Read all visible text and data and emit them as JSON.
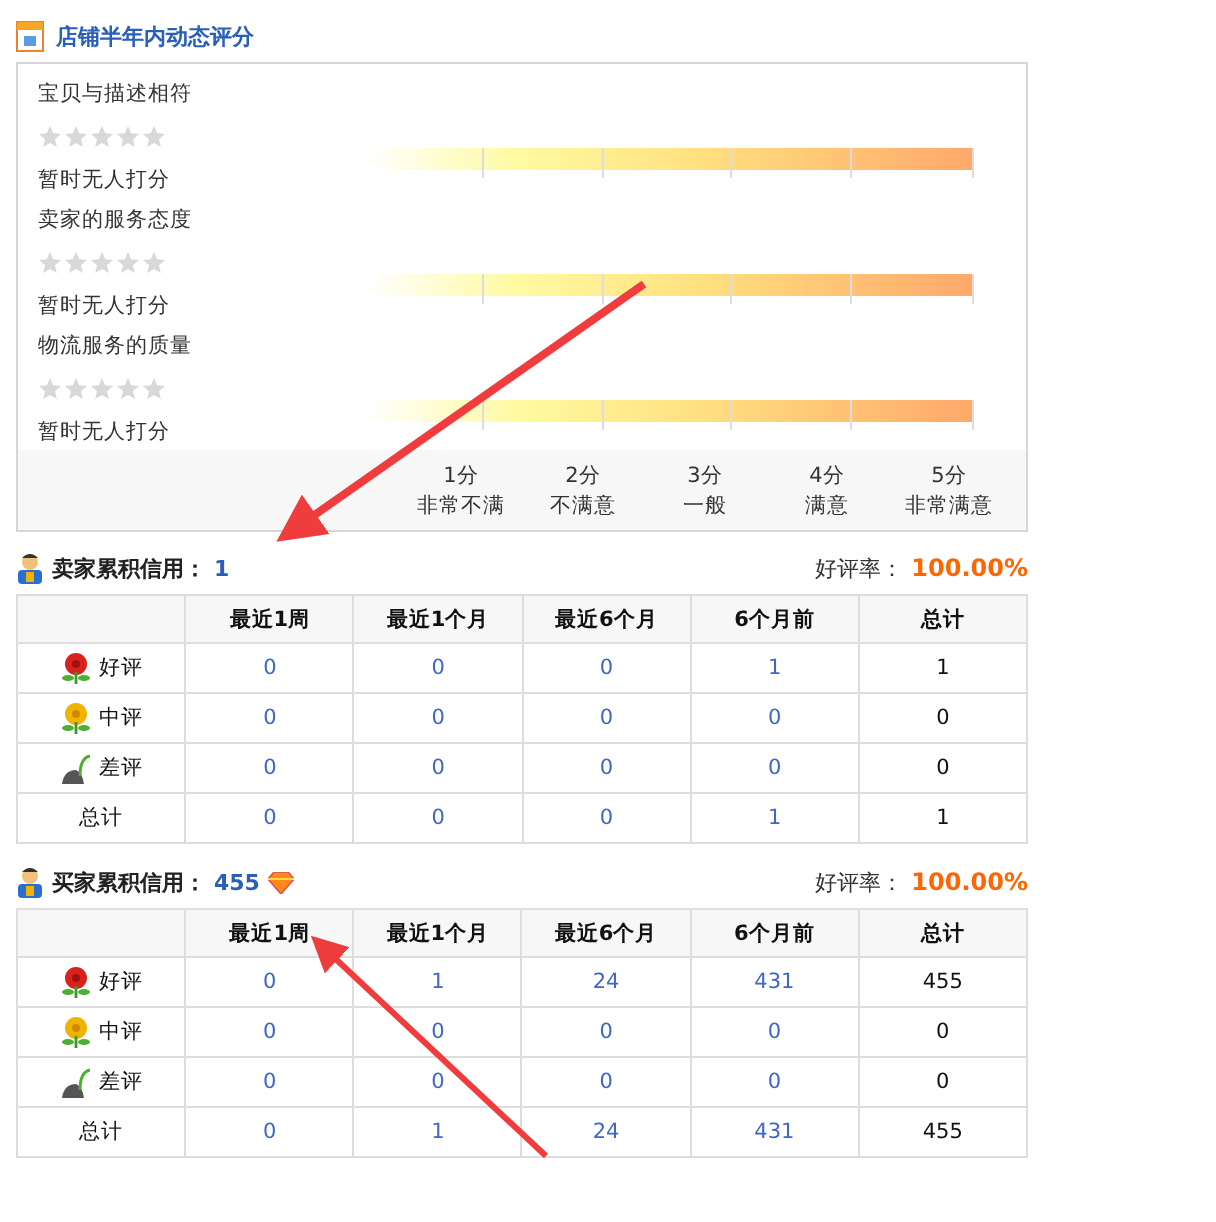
{
  "dsr": {
    "title": "店铺半年内动态评分",
    "ratings": [
      {
        "label": "宝贝与描述相符",
        "stars": 0,
        "status": "暂时无人打分"
      },
      {
        "label": "卖家的服务态度",
        "stars": 0,
        "status": "暂时无人打分"
      },
      {
        "label": "物流服务的质量",
        "stars": 0,
        "status": "暂时无人打分"
      }
    ],
    "scale": [
      {
        "score": "1分",
        "meaning": "非常不满"
      },
      {
        "score": "2分",
        "meaning": "不满意"
      },
      {
        "score": "3分",
        "meaning": "一般"
      },
      {
        "score": "4分",
        "meaning": "满意"
      },
      {
        "score": "5分",
        "meaning": "非常满意"
      }
    ]
  },
  "credits": [
    {
      "label": "卖家累积信用：",
      "value": "1",
      "badge": false,
      "rate_label": "好评率：",
      "rate": "100.00%",
      "columns": [
        "最近1周",
        "最近1个月",
        "最近6个月",
        "6个月前",
        "总计"
      ],
      "rows": [
        {
          "kind": "good",
          "label": "好评",
          "cells": [
            "0",
            "0",
            "0",
            "1",
            "1"
          ]
        },
        {
          "kind": "neutral",
          "label": "中评",
          "cells": [
            "0",
            "0",
            "0",
            "0",
            "0"
          ]
        },
        {
          "kind": "bad",
          "label": "差评",
          "cells": [
            "0",
            "0",
            "0",
            "0",
            "0"
          ]
        },
        {
          "kind": "total",
          "label": "总计",
          "cells": [
            "0",
            "0",
            "0",
            "1",
            "1"
          ]
        }
      ]
    },
    {
      "label": "买家累积信用：",
      "value": "455",
      "badge": true,
      "rate_label": "好评率：",
      "rate": "100.00%",
      "columns": [
        "最近1周",
        "最近1个月",
        "最近6个月",
        "6个月前",
        "总计"
      ],
      "rows": [
        {
          "kind": "good",
          "label": "好评",
          "cells": [
            "0",
            "1",
            "24",
            "431",
            "455"
          ]
        },
        {
          "kind": "neutral",
          "label": "中评",
          "cells": [
            "0",
            "0",
            "0",
            "0",
            "0"
          ]
        },
        {
          "kind": "bad",
          "label": "差评",
          "cells": [
            "0",
            "0",
            "0",
            "0",
            "0"
          ]
        },
        {
          "kind": "total",
          "label": "总计",
          "cells": [
            "0",
            "1",
            "24",
            "431",
            "455"
          ]
        }
      ]
    }
  ]
}
